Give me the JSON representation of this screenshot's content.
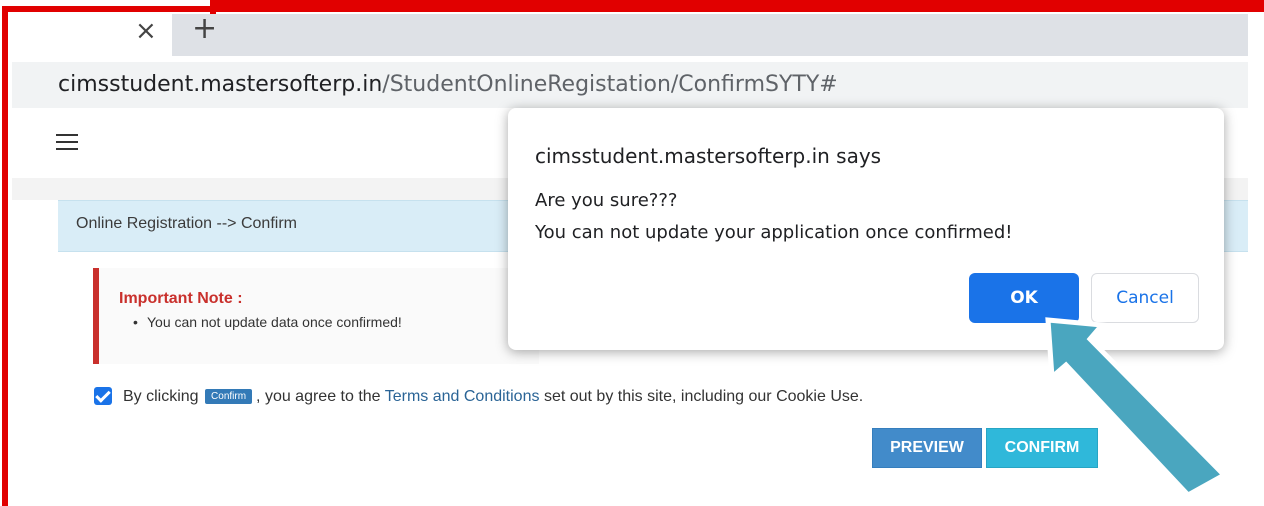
{
  "browser": {
    "tab_close_icon": "×",
    "new_tab_icon": "+",
    "url_host": "cimsstudent.mastersofterp.in",
    "url_path": "/StudentOnlineRegistation/ConfirmSYTY#"
  },
  "page": {
    "breadcrumb": "Online Registration --> Confirm",
    "note_title": "Important Note :",
    "note_items": [
      "You can not update data once confirmed!"
    ],
    "agree": {
      "prefix": "By clicking",
      "chip": "Confirm",
      "middle": ", you agree to the",
      "link": "Terms and Conditions",
      "suffix": "set out by this site, including our Cookie Use."
    },
    "preview_label": "PREVIEW",
    "confirm_label": "CONFIRM"
  },
  "dialog": {
    "title": "cimsstudent.mastersofterp.in says",
    "line1": "Are you sure???",
    "line2": "You can not update your application once confirmed!",
    "ok_label": "OK",
    "cancel_label": "Cancel"
  },
  "colors": {
    "annotation_frame": "#e10000",
    "annotation_arrow": "#4aa6bf",
    "ok_button": "#1a73e8"
  },
  "icons": [
    "close-icon",
    "plus-icon",
    "hamburger-icon",
    "checkbox-checked-icon",
    "arrow-annotation-icon"
  ]
}
